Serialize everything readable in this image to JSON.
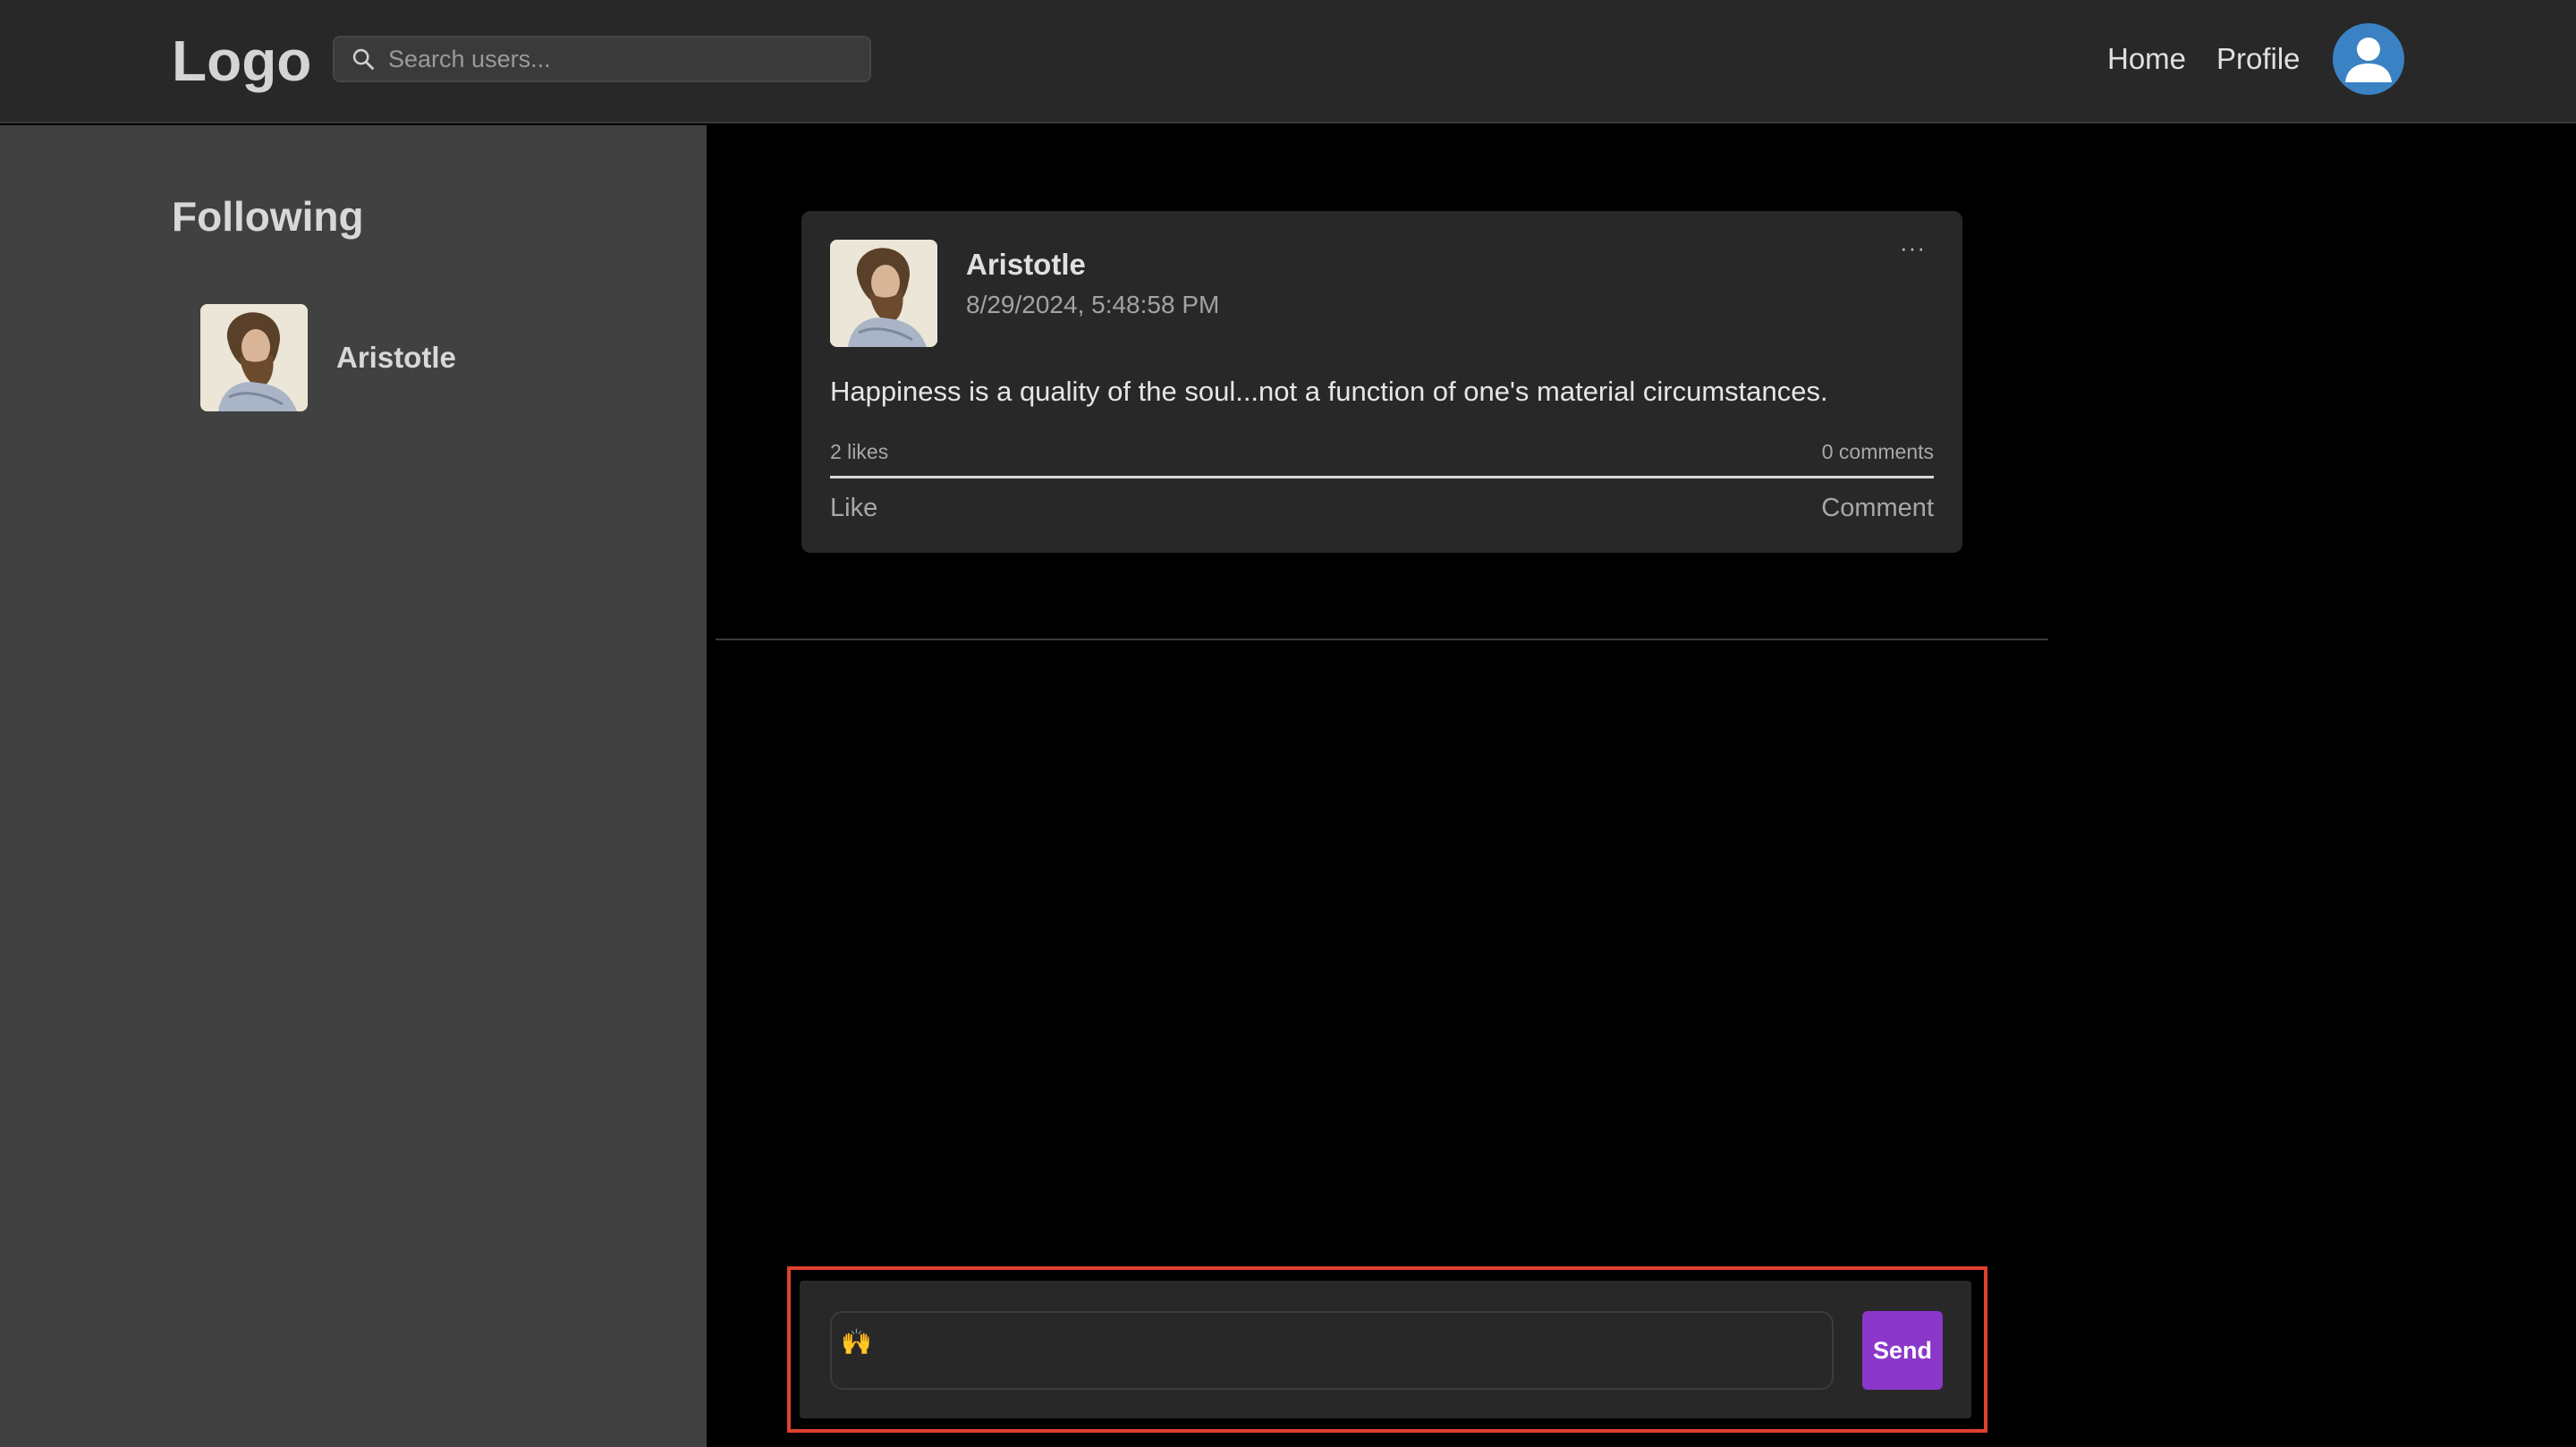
{
  "header": {
    "logo": "Logo",
    "search_placeholder": "Search users...",
    "nav": {
      "home": "Home",
      "profile": "Profile"
    }
  },
  "sidebar": {
    "title": "Following",
    "items": [
      {
        "name": "Aristotle"
      }
    ]
  },
  "post": {
    "author": "Aristotle",
    "timestamp": "8/29/2024, 5:48:58 PM",
    "text": "Happiness is a quality of the soul...not a function of one's material circumstances.",
    "likes": "2 likes",
    "comments": "0 comments",
    "like_label": "Like",
    "comment_label": "Comment",
    "more": "···"
  },
  "composer": {
    "value": "🙌",
    "send_label": "Send"
  },
  "colors": {
    "header_bg": "#282828",
    "sidebar_bg": "#414141",
    "card_bg": "#282828",
    "accent": "#8b37c9",
    "highlight_outline": "#e0402f",
    "avatar_blue": "#3b82c4"
  }
}
